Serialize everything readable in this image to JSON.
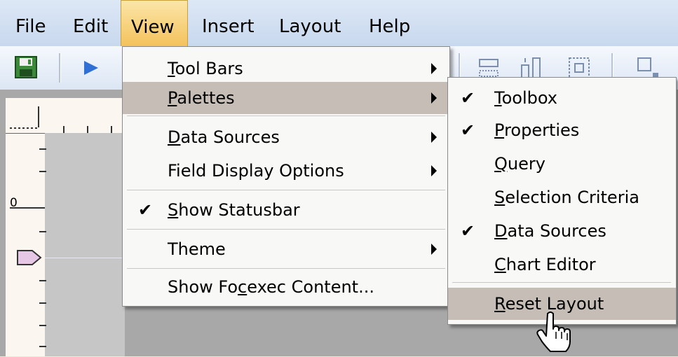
{
  "menubar": {
    "items": [
      {
        "label": "File"
      },
      {
        "label": "Edit"
      },
      {
        "label": "View"
      },
      {
        "label": "Insert"
      },
      {
        "label": "Layout"
      },
      {
        "label": "Help"
      }
    ]
  },
  "toolbar": {
    "buttons": [
      "save-icon",
      "run-icon",
      "layout-icon-1",
      "layout-icon-2",
      "layout-icon-3",
      "layout-icon-4"
    ]
  },
  "ruler": {
    "zero_label": "0"
  },
  "view_menu": {
    "items": [
      {
        "mnemonic": "T",
        "rest": "ool Bars",
        "submenu": true
      },
      {
        "mnemonic": "P",
        "rest": "alettes",
        "submenu": true,
        "highlighted": true
      },
      {
        "mnemonic": "D",
        "rest": "ata Sources",
        "submenu": true
      },
      {
        "label": "Field Display Options",
        "submenu": true
      },
      {
        "mnemonic": "S",
        "rest": "how Statusbar",
        "checked": true
      },
      {
        "label": "Theme",
        "submenu": true
      },
      {
        "pre": "Show Fo",
        "mnemonic": "c",
        "rest": "exec Content..."
      }
    ]
  },
  "palettes_menu": {
    "items": [
      {
        "mnemonic": "T",
        "rest": "oolbox",
        "checked": true
      },
      {
        "mnemonic": "P",
        "rest": "roperties",
        "checked": true
      },
      {
        "mnemonic": "Q",
        "rest": "uery",
        "checked": false
      },
      {
        "mnemonic": "S",
        "rest": "election Criteria",
        "checked": false
      },
      {
        "mnemonic": "D",
        "rest": "ata Sources",
        "checked": true
      },
      {
        "mnemonic": "C",
        "rest": "hart Editor",
        "checked": false
      },
      {
        "mnemonic": "R",
        "rest": "eset Layout",
        "checked": false,
        "highlighted": true
      }
    ]
  },
  "colors": {
    "menu_highlight": "#c6beb6",
    "active_menubar": "#f4c25c",
    "menubar_bg": "#c8d8ee"
  }
}
